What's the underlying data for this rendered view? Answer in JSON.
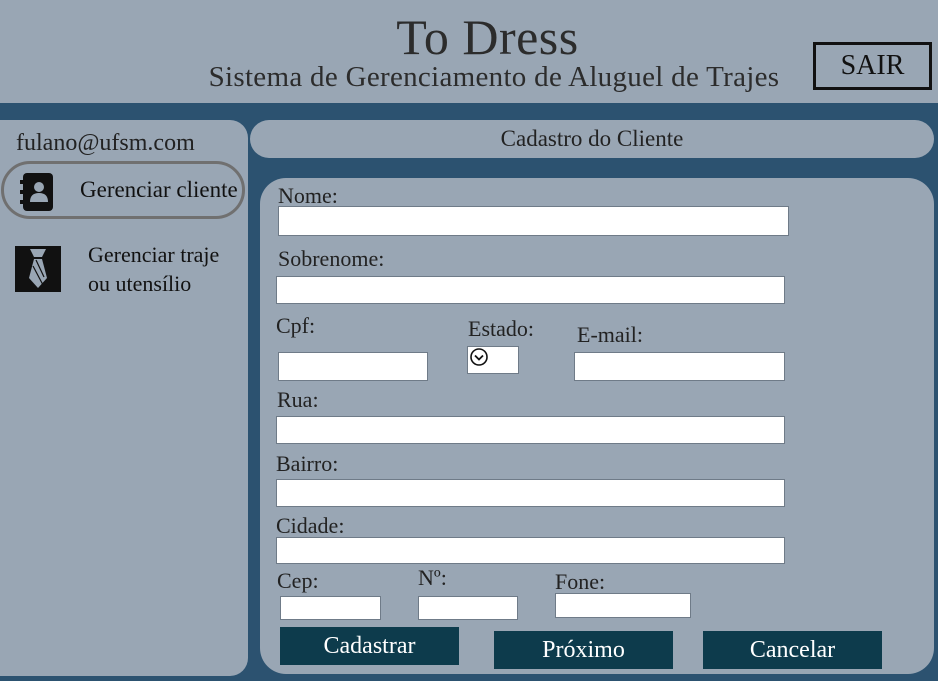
{
  "header": {
    "title": "To Dress",
    "subtitle": "Sistema de Gerenciamento de Aluguel de Trajes",
    "logout_label": "SAIR"
  },
  "sidebar": {
    "user_email": "fulano@ufsm.com",
    "items": [
      {
        "label": "Gerenciar cliente",
        "icon": "address-book-icon"
      },
      {
        "label_line1": "Gerenciar traje",
        "label_line2": "ou utensílio",
        "icon": "necktie-icon"
      }
    ]
  },
  "form": {
    "title": "Cadastro do Cliente",
    "labels": {
      "nome": "Nome:",
      "sobrenome": "Sobrenome:",
      "cpf": "Cpf:",
      "estado": "Estado:",
      "email": "E-mail:",
      "rua": "Rua:",
      "bairro": "Bairro:",
      "cidade": "Cidade:",
      "cep": "Cep:",
      "numero": "Nº:",
      "fone": "Fone:"
    },
    "values": {
      "nome": "",
      "sobrenome": "",
      "cpf": "",
      "estado": "",
      "email": "",
      "rua": "",
      "bairro": "",
      "cidade": "",
      "cep": "",
      "numero": "",
      "fone": ""
    },
    "buttons": {
      "register": "Cadastrar",
      "next": "Próximo",
      "cancel": "Cancelar"
    }
  },
  "colors": {
    "background": "#2c5270",
    "panel": "#99a6b4",
    "button": "#0d3b4c"
  }
}
